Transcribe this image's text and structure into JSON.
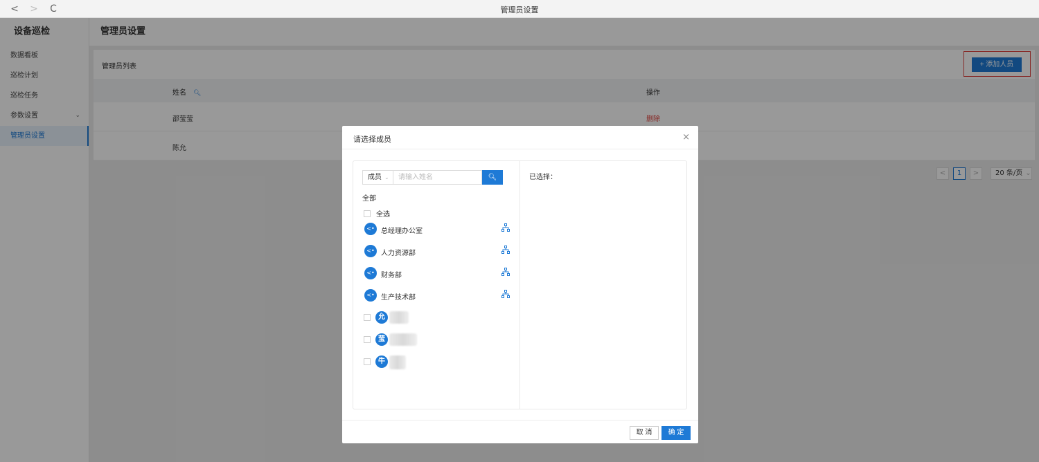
{
  "browser": {
    "title": "管理员设置",
    "back": "<",
    "forward": ">",
    "reload": "C"
  },
  "sidebar": {
    "brand": "设备巡检",
    "items": [
      {
        "label": "数据看板"
      },
      {
        "label": "巡检计划"
      },
      {
        "label": "巡检任务"
      },
      {
        "label": "参数设置",
        "has_chevron": true
      },
      {
        "label": "管理员设置",
        "active": true
      }
    ],
    "chevron": "⌄"
  },
  "main": {
    "title": "管理员设置",
    "panel_label": "管理员列表",
    "add_button": "+ 添加人员",
    "columns": {
      "name": "姓名",
      "action": "操作"
    },
    "rows": [
      {
        "name": "邵莹莹",
        "action": "删除"
      },
      {
        "name": "陈允",
        "action": ""
      }
    ],
    "pagination": {
      "prev": "<",
      "current": "1",
      "next": ">",
      "page_size": "20 条/页",
      "size_chevron": "⌄"
    }
  },
  "modal": {
    "title": "请选择成员",
    "close": "×",
    "search": {
      "type": "成员",
      "type_chevron": "⌄",
      "placeholder": "请输入姓名"
    },
    "all_label": "全部",
    "select_all": "全选",
    "departments": [
      {
        "name": "总经理办公室"
      },
      {
        "name": "人力资源部"
      },
      {
        "name": "财务部"
      },
      {
        "name": "生产技术部"
      }
    ],
    "members": [
      {
        "avatar": "允"
      },
      {
        "avatar": "莹"
      },
      {
        "avatar": "牛"
      }
    ],
    "selected_label": "已选择：",
    "cancel": "取 消",
    "confirm": "确 定"
  },
  "colors": {
    "primary": "#1e7ad6",
    "danger": "#e0443e",
    "mask": "rgba(0,0,0,0.4)"
  }
}
